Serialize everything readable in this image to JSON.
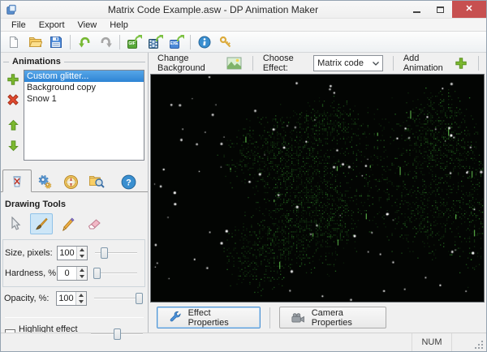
{
  "window": {
    "title": "Matrix Code Example.asw - DP Animation Maker",
    "icons": [
      "app-icon",
      "minimize-icon",
      "maximize-icon",
      "close-icon"
    ]
  },
  "menu": {
    "items": [
      "File",
      "Export",
      "View",
      "Help"
    ]
  },
  "toolbar": {
    "icons": [
      "new-file-icon",
      "open-file-icon",
      "save-icon",
      "undo-icon",
      "redo-icon",
      "export-gif-icon",
      "export-video-icon",
      "export-exe-icon",
      "info-icon",
      "license-key-icon"
    ],
    "badges": {
      "gif": "GIF",
      "exe": "EXE"
    },
    "glyphs": {
      "info": "i"
    }
  },
  "animations_panel": {
    "title": "Animations",
    "items": [
      "Custom glitter...",
      "Background copy",
      "Snow 1"
    ],
    "selected_index": 0,
    "buttons": [
      "add-animation",
      "delete-animation",
      "move-up",
      "move-down"
    ]
  },
  "tools_panel": {
    "tabs": [
      "drawing-tools",
      "effect-settings",
      "navigation",
      "browse-library",
      "help"
    ],
    "help_glyph": "?",
    "section_title": "Drawing Tools",
    "tools": [
      "select-tool",
      "brush-tool",
      "pencil-tool",
      "eraser-tool"
    ],
    "selected_tool": "brush-tool",
    "controls": [
      {
        "label": "Size, pixels:",
        "value": "100",
        "slider_percent": 22
      },
      {
        "label": "Hardness, %:",
        "value": "0",
        "slider_percent": 3
      },
      {
        "label": "Opacity, %:",
        "value": "100",
        "slider_percent": 100
      }
    ],
    "highlight": {
      "label": "Highlight effect area",
      "checked": false,
      "slider_percent": 50
    }
  },
  "effect_bar": {
    "change_background_label": "Change Background",
    "choose_effect_label": "Choose Effect:",
    "effect_value": "Matrix code",
    "add_animation_label": "Add Animation",
    "chevron": "⌄"
  },
  "properties_bar": {
    "effect_button": "Effect Properties",
    "camera_button": "Camera Properties"
  },
  "statusbar": {
    "num_indicator": "NUM"
  },
  "colors": {
    "selection_blue": "#3a92dd",
    "accent_green": "#7cb82f",
    "delete_red": "#d9372a",
    "close_red": "#c75050",
    "panel_bg": "#f0f0f0",
    "matrix_green": "#4eb830"
  },
  "canvas_effect": {
    "background": "#030503",
    "seed": 1337,
    "dot_step": 2,
    "green_base": [
      42,
      185
    ],
    "blobs": [
      [
        0.38,
        0.36,
        0.2,
        0.24,
        0.5
      ],
      [
        0.53,
        0.2,
        0.13,
        0.14,
        0.45
      ],
      [
        0.47,
        0.64,
        0.18,
        0.28,
        0.5
      ],
      [
        0.33,
        0.78,
        0.14,
        0.22,
        0.45
      ],
      [
        0.86,
        0.26,
        0.14,
        0.26,
        0.52
      ],
      [
        0.83,
        0.62,
        0.13,
        0.22,
        0.42
      ],
      [
        0.63,
        0.45,
        0.34,
        0.4,
        0.18
      ],
      [
        0.96,
        0.55,
        0.1,
        0.45,
        0.3
      ]
    ],
    "streak_count": 28,
    "star_count": 92
  }
}
